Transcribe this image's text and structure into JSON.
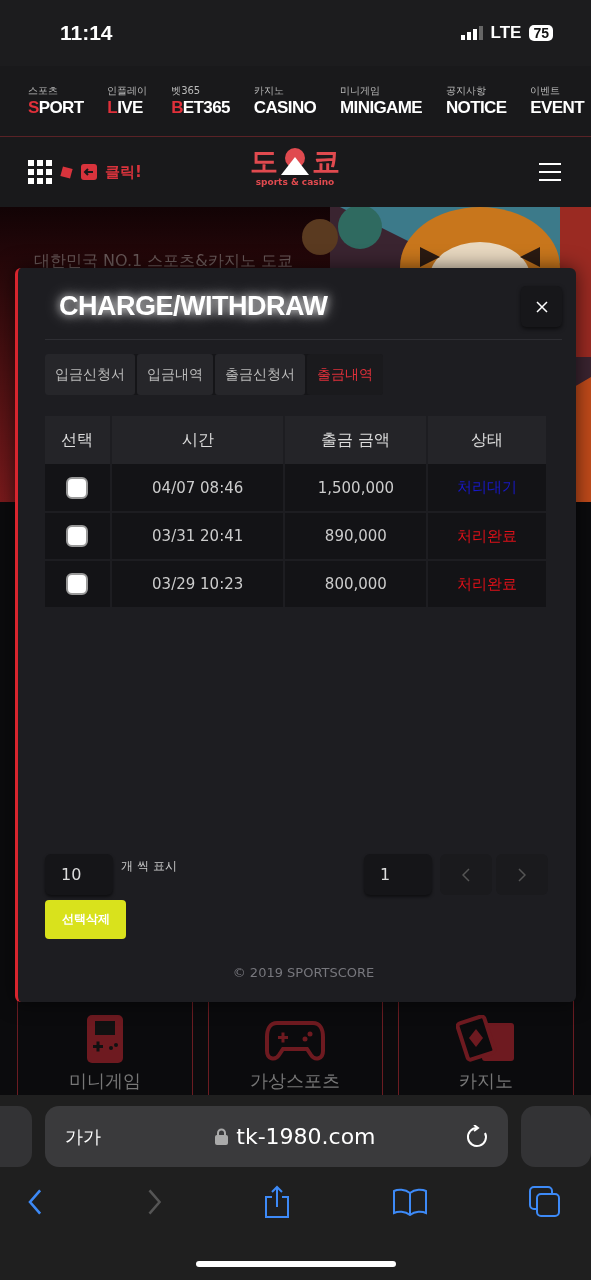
{
  "status_bar": {
    "time": "11:14",
    "network": "LTE",
    "battery": "75"
  },
  "top_nav": [
    {
      "caption": "스포츠",
      "label": "SPORT",
      "accent_initial": true
    },
    {
      "caption": "인플레이",
      "label": "LIVE",
      "accent_initial": true
    },
    {
      "caption": "벳365",
      "label": "BET365",
      "accent_initial": true
    },
    {
      "caption": "카지노",
      "label": "CASINO",
      "accent_initial": false
    },
    {
      "caption": "미니게임",
      "label": "MINIGAME",
      "accent_initial": false
    },
    {
      "caption": "공지사항",
      "label": "NOTICE",
      "accent_initial": false
    },
    {
      "caption": "이벤트",
      "label": "EVENT",
      "accent_initial": false
    }
  ],
  "header": {
    "click_label": "클릭!",
    "logo": {
      "left": "도",
      "right": "쿄",
      "subtitle": "sports & casino"
    }
  },
  "banner": {
    "headline": "대한민국 NO.1 스포츠&카지노 도쿄"
  },
  "modal": {
    "title": "CHARGE/WITHDRAW",
    "tabs": [
      {
        "label": "입금신청서",
        "selected": false
      },
      {
        "label": "입금내역",
        "selected": false
      },
      {
        "label": "출금신청서",
        "selected": false
      },
      {
        "label": "출금내역",
        "selected": true
      }
    ],
    "table": {
      "columns": [
        "선택",
        "시간",
        "출금 금액",
        "상태"
      ],
      "rows": [
        {
          "checked": false,
          "time": "04/07 08:46",
          "amount": "1,500,000",
          "status": "처리대기",
          "color": "#1818c8"
        },
        {
          "checked": false,
          "time": "03/31 20:41",
          "amount": "890,000",
          "status": "처리완료",
          "color": "#e01018"
        },
        {
          "checked": false,
          "time": "03/29 10:23",
          "amount": "800,000",
          "status": "처리완료",
          "color": "#e01018"
        }
      ]
    },
    "page_size": "10",
    "page_size_label": "개 씩 표시",
    "page": "1",
    "delete_button": "선택삭제",
    "footer": "© 2019 SPORTSCORE"
  },
  "game_tiles": [
    {
      "label": "미니게임",
      "kind": "handheld"
    },
    {
      "label": "가상스포츠",
      "kind": "gamepad"
    },
    {
      "label": "카지노",
      "kind": "cards"
    }
  ],
  "browser": {
    "text_size": "가가",
    "url": "tk-1980.com"
  }
}
